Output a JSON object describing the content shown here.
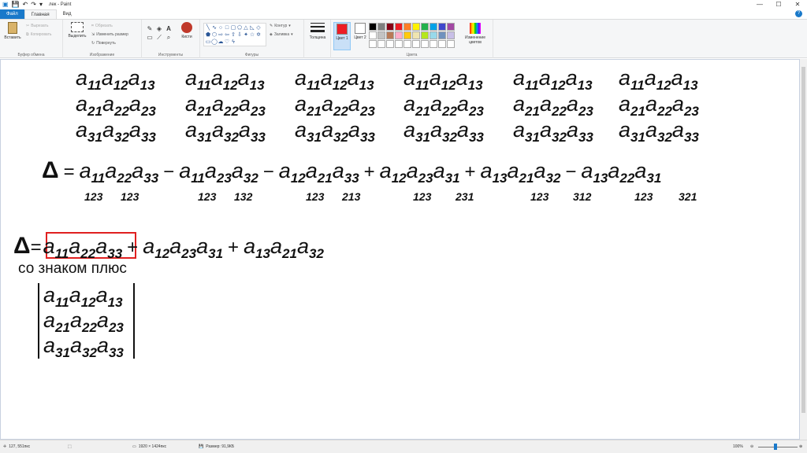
{
  "window": {
    "title": "лек - Paint"
  },
  "quick_access": [
    "💾",
    "↶",
    "↷",
    "▾"
  ],
  "window_buttons": [
    "—",
    "☐",
    "✕"
  ],
  "tabs": {
    "file": "Файл",
    "home": "Главная",
    "view": "Вид",
    "help": "?"
  },
  "ribbon": {
    "clipboard": {
      "paste": "Вставить",
      "cut": "Вырезать",
      "copy": "Копировать",
      "label": "Буфер обмена"
    },
    "image": {
      "select": "Выделить",
      "crop": "Обрезать",
      "resize": "Изменить размер",
      "rotate": "Повернуть",
      "label": "Изображение"
    },
    "tools": {
      "label": "Инструменты",
      "brushes": "Кисти"
    },
    "shapes": {
      "label": "Фигуры",
      "outline": "Контур",
      "fill": "Заливка"
    },
    "size": {
      "label": "Толщина"
    },
    "colors": {
      "color1": "Цвет 1",
      "color2": "Цвет 2",
      "edit": "Изменение цветов",
      "label": "Цвета",
      "color1_value": "#ed1c24",
      "color2_value": "#ffffff"
    },
    "palette": [
      "#000000",
      "#7f7f7f",
      "#880015",
      "#ed1c24",
      "#ff7f27",
      "#fff200",
      "#22b14c",
      "#00a2e8",
      "#3f48cc",
      "#a349a4",
      "#ffffff",
      "#c3c3c3",
      "#b97a57",
      "#ffaec9",
      "#ffc90e",
      "#efe4b0",
      "#b5e61d",
      "#99d9ea",
      "#7092be",
      "#c8bfe7",
      "#ffffff",
      "#ffffff",
      "#ffffff",
      "#ffffff",
      "#ffffff",
      "#ffffff",
      "#ffffff",
      "#ffffff",
      "#ffffff",
      "#ffffff"
    ]
  },
  "canvas": {
    "rows": [
      "11",
      "12",
      "13",
      "21",
      "22",
      "23",
      "31",
      "32",
      "33"
    ],
    "delta_terms": [
      {
        "sign": "",
        "subs": [
          "11",
          "22",
          "33"
        ],
        "perm": [
          "123",
          "123"
        ]
      },
      {
        "sign": "−",
        "subs": [
          "11",
          "23",
          "32"
        ],
        "perm": [
          "123",
          "132"
        ]
      },
      {
        "sign": "−",
        "subs": [
          "12",
          "21",
          "33"
        ],
        "perm": [
          "123",
          "213"
        ]
      },
      {
        "sign": "+",
        "subs": [
          "12",
          "23",
          "31"
        ],
        "perm": [
          "123",
          "231"
        ]
      },
      {
        "sign": "+",
        "subs": [
          "13",
          "21",
          "32"
        ],
        "perm": [
          "123",
          "312"
        ]
      },
      {
        "sign": "−",
        "subs": [
          "13",
          "22",
          "31"
        ],
        "perm": [
          "123",
          "321"
        ]
      }
    ],
    "delta_symbol": "Δ",
    "equals": "=",
    "second_terms": [
      {
        "sign": "",
        "subs": [
          "11",
          "22",
          "33"
        ]
      },
      {
        "sign": "+",
        "subs": [
          "12",
          "23",
          "31"
        ]
      },
      {
        "sign": "+",
        "subs": [
          "13",
          "21",
          "32"
        ]
      }
    ],
    "caption": "со знаком плюс"
  },
  "status": {
    "cursor": "127, 551пкс",
    "size": "1920 × 1424пкс",
    "filesize": "Размер: 91,9КБ",
    "zoom": "100%"
  }
}
